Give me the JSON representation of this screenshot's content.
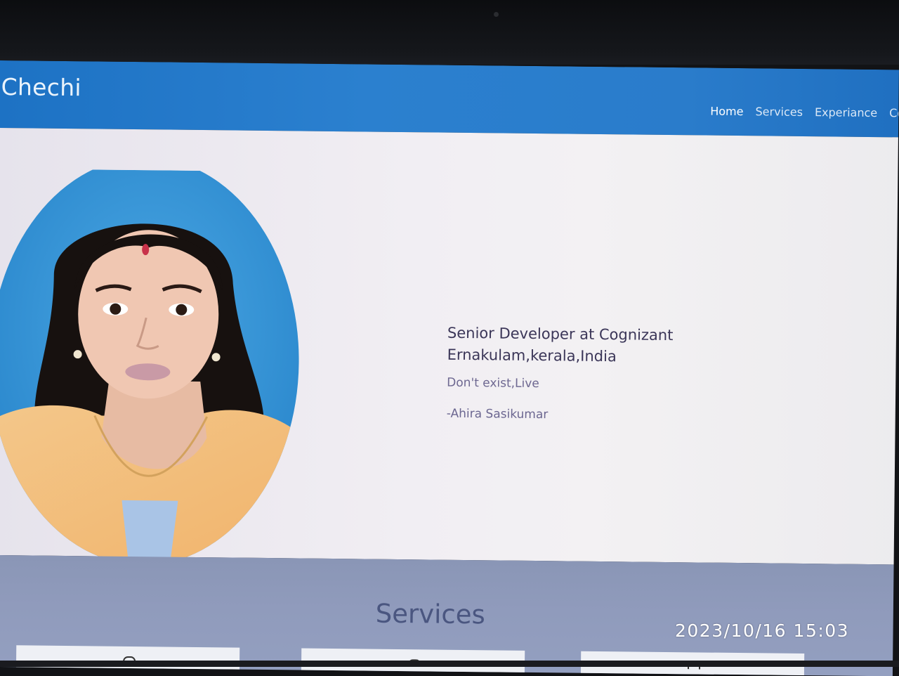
{
  "navbar": {
    "brand": "Chechi",
    "links": [
      "Home",
      "Services",
      "Experiance",
      "Cor"
    ]
  },
  "hero": {
    "headline_line1": "Senior Developer at Cognizant",
    "headline_line2": "Ernakulam,kerala,India",
    "quote": "Don't exist,Live",
    "author": "-Ahira Sasikumar"
  },
  "services": {
    "title": "Services"
  },
  "overlay": {
    "timestamp": "2023/10/16 15:03"
  },
  "colors": {
    "navbar": "#2b80cf",
    "portrait_background": "#2f8fd3",
    "services_band": "#909bbc"
  },
  "icons": [
    "portrait-photo",
    "service-icon"
  ]
}
